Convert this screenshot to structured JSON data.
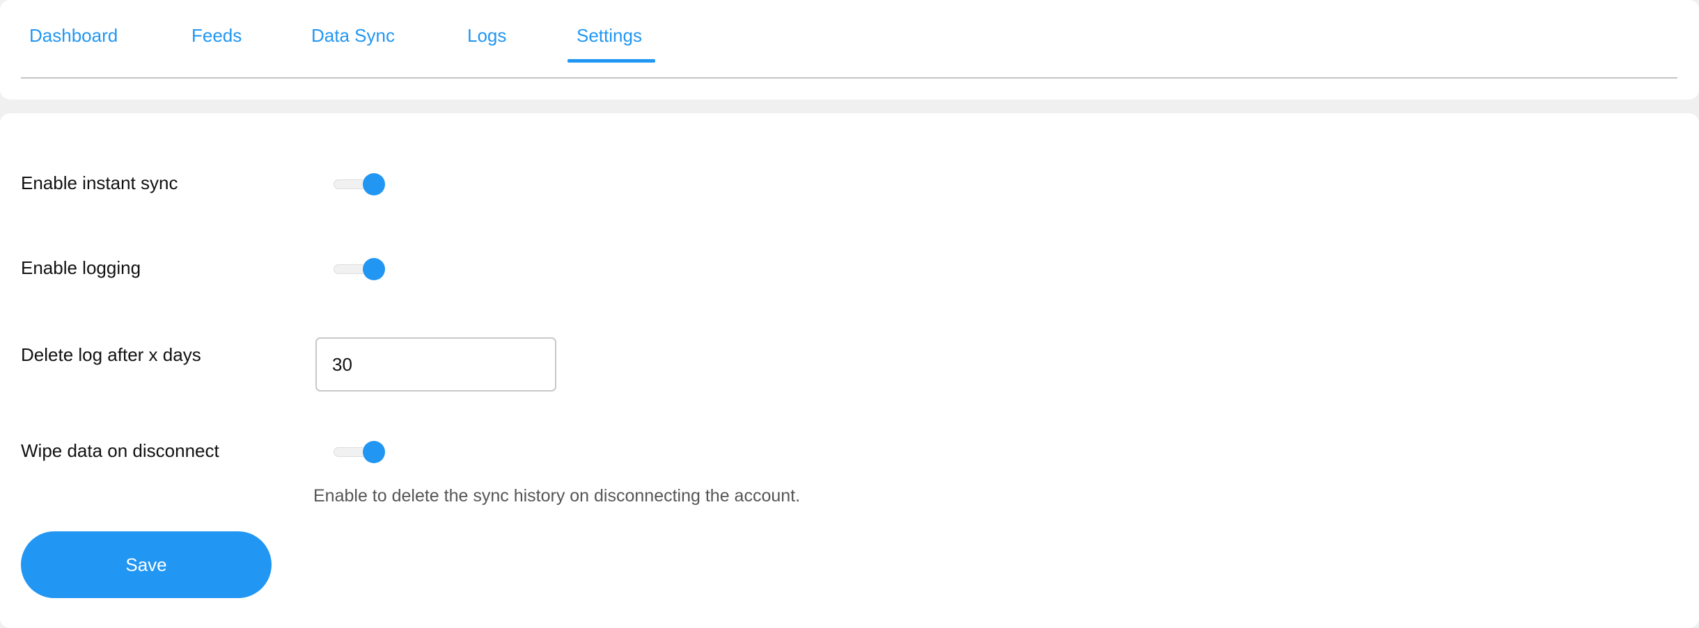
{
  "nav": {
    "tabs": [
      {
        "label": "Dashboard"
      },
      {
        "label": "Feeds"
      },
      {
        "label": "Data Sync"
      },
      {
        "label": "Logs"
      },
      {
        "label": "Settings",
        "active": true
      }
    ]
  },
  "settings": {
    "instant_sync": {
      "label": "Enable instant sync",
      "enabled": true
    },
    "logging": {
      "label": "Enable logging",
      "enabled": true
    },
    "delete_log": {
      "label": "Delete log after x days",
      "value": "30"
    },
    "wipe_data": {
      "label": "Wipe data on disconnect",
      "enabled": true,
      "help": "Enable to delete the sync history on disconnecting the account."
    },
    "save_label": "Save"
  },
  "colors": {
    "accent": "#2196f3"
  }
}
